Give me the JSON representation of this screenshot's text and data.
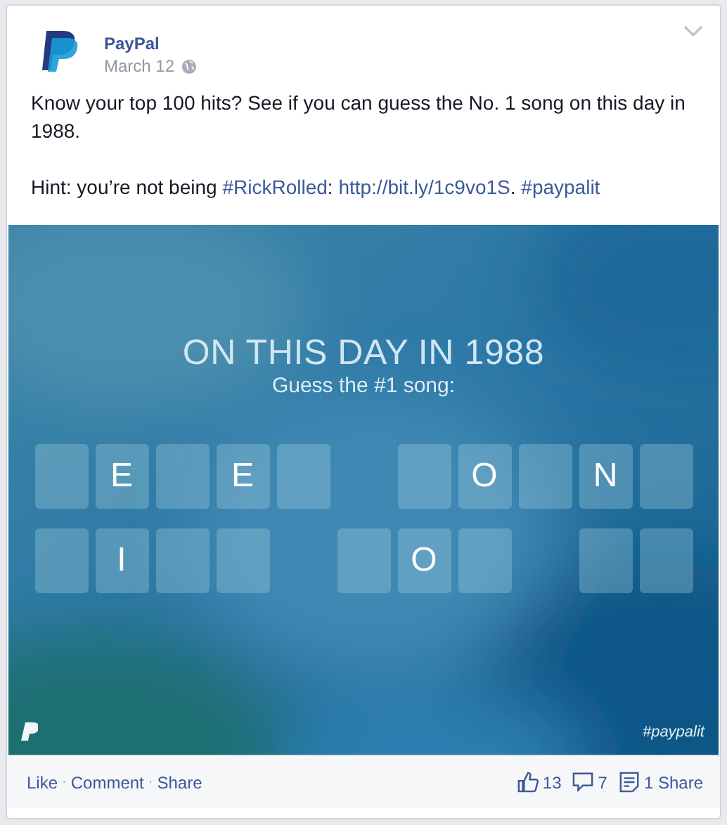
{
  "post": {
    "author": "PayPal",
    "date": "March 12",
    "paragraphs": [
      [
        {
          "kind": "plain",
          "text": "Know your top 100 hits? See if you can guess the No. 1 song on this day in 1988."
        }
      ],
      [
        {
          "kind": "plain",
          "text": "Hint: you’re not being "
        },
        {
          "kind": "hashtag",
          "text": "#RickRolled"
        },
        {
          "kind": "plain",
          "text": ": "
        },
        {
          "kind": "link",
          "text": "http://bit.ly/1c9vo1S"
        },
        {
          "kind": "plain",
          "text": ". "
        },
        {
          "kind": "hashtag",
          "text": "#paypalit"
        }
      ]
    ]
  },
  "graphic": {
    "title": "ON THIS DAY IN 1988",
    "subtitle": "Guess the #1 song:",
    "hashtag": "#paypalit",
    "rows": [
      [
        {
          "kind": "blank"
        },
        {
          "kind": "letter",
          "letter": "E"
        },
        {
          "kind": "blank"
        },
        {
          "kind": "letter",
          "letter": "E"
        },
        {
          "kind": "blank"
        },
        {
          "kind": "gap"
        },
        {
          "kind": "blank"
        },
        {
          "kind": "letter",
          "letter": "O"
        },
        {
          "kind": "blank"
        },
        {
          "kind": "letter",
          "letter": "N"
        },
        {
          "kind": "blank"
        }
      ],
      [
        {
          "kind": "blank"
        },
        {
          "kind": "letter",
          "letter": "I"
        },
        {
          "kind": "blank"
        },
        {
          "kind": "blank"
        },
        {
          "kind": "gap"
        },
        {
          "kind": "blank"
        },
        {
          "kind": "letter",
          "letter": "O"
        },
        {
          "kind": "blank"
        },
        {
          "kind": "gap"
        },
        {
          "kind": "blank"
        },
        {
          "kind": "blank"
        }
      ]
    ]
  },
  "actions": [
    {
      "label": "Like"
    },
    {
      "label": "Comment"
    },
    {
      "label": "Share"
    }
  ],
  "separators": [
    "·",
    "·"
  ],
  "stats": [
    {
      "kind": "likes",
      "count": "13"
    },
    {
      "kind": "comments",
      "count": "7"
    },
    {
      "kind": "shares",
      "count": "1 Share"
    }
  ]
}
